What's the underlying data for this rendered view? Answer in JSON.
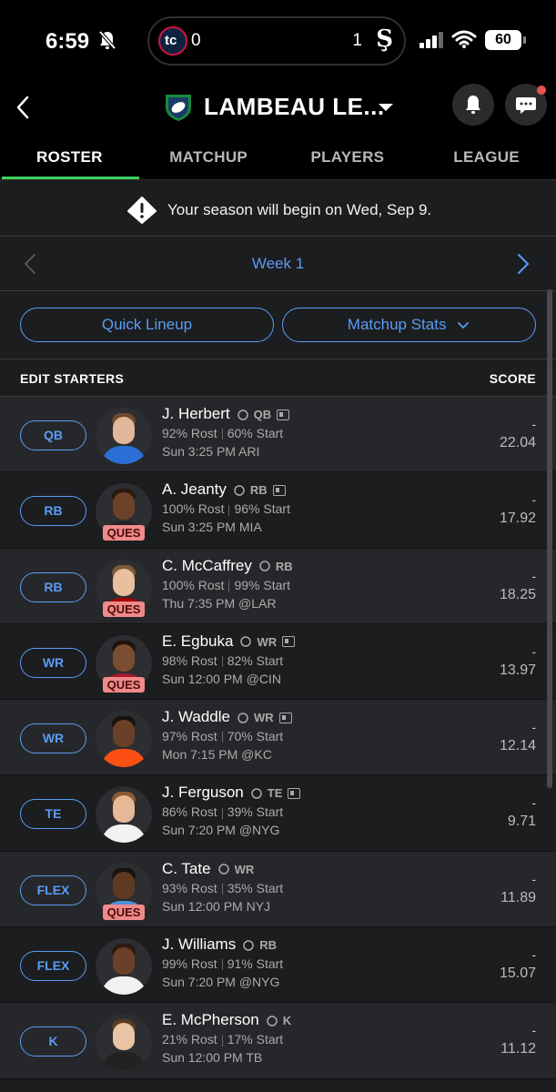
{
  "status_bar": {
    "time": "6:59",
    "live_score": {
      "team_a_score": "0",
      "team_b_score": "1"
    },
    "battery": "60"
  },
  "header": {
    "league_name": "LAMBEAU LE..."
  },
  "tabs": [
    {
      "label": "ROSTER",
      "active": true
    },
    {
      "label": "MATCHUP",
      "active": false
    },
    {
      "label": "PLAYERS",
      "active": false
    },
    {
      "label": "LEAGUE",
      "active": false
    }
  ],
  "notice": {
    "text": "Your season will begin on Wed, Sep 9."
  },
  "week": {
    "label": "Week 1"
  },
  "actions": {
    "quick_lineup": "Quick Lineup",
    "matchup_stats": "Matchup Stats"
  },
  "table_header": {
    "left": "EDIT STARTERS",
    "right": "SCORE"
  },
  "players": [
    {
      "slot": "QB",
      "name": "J. Herbert",
      "pos": "QB",
      "team_icon": "chargers-icon",
      "rost": "92% Rost",
      "start": "60% Start",
      "game": "Sun 3:25 PM  ARI",
      "score": "-",
      "proj": "22.04",
      "ques": false,
      "news": true,
      "skin": "#e2b89a",
      "hair": "#6b4a2e",
      "jersey": "#2a6fd6"
    },
    {
      "slot": "RB",
      "name": "A. Jeanty",
      "pos": "RB",
      "team_icon": "raiders-icon",
      "rost": "100% Rost",
      "start": "96% Start",
      "game": "Sun 3:25 PM  MIA",
      "score": "-",
      "proj": "17.92",
      "ques": true,
      "news": true,
      "skin": "#6b4228",
      "hair": "#2a1a10",
      "jersey": "#222"
    },
    {
      "slot": "RB",
      "name": "C. McCaffrey",
      "pos": "RB",
      "team_icon": "49ers-icon",
      "rost": "100% Rost",
      "start": "99% Start",
      "game": "Thu 7:35 PM  @LAR",
      "score": "-",
      "proj": "18.25",
      "ques": true,
      "news": false,
      "skin": "#e8c0a0",
      "hair": "#7a5a3a",
      "jersey": "#aa0000"
    },
    {
      "slot": "WR",
      "name": "E. Egbuka",
      "pos": "WR",
      "team_icon": "buccaneers-icon",
      "rost": "98% Rost",
      "start": "82% Start",
      "game": "Sun 12:00 PM  @CIN",
      "score": "-",
      "proj": "13.97",
      "ques": true,
      "news": true,
      "skin": "#7a4c30",
      "hair": "#1e140c",
      "jersey": "#a71930"
    },
    {
      "slot": "WR",
      "name": "J. Waddle",
      "pos": "WR",
      "team_icon": "broncos-icon",
      "rost": "97% Rost",
      "start": "70% Start",
      "game": "Mon 7:15 PM  @KC",
      "score": "-",
      "proj": "12.14",
      "ques": false,
      "news": true,
      "skin": "#6a4028",
      "hair": "#1a120c",
      "jersey": "#fb4f14"
    },
    {
      "slot": "TE",
      "name": "J. Ferguson",
      "pos": "TE",
      "team_icon": "cowboys-icon",
      "rost": "86% Rost",
      "start": "39% Start",
      "game": "Sun 7:20 PM  @NYG",
      "score": "-",
      "proj": "9.71",
      "ques": false,
      "news": true,
      "skin": "#e6b896",
      "hair": "#8a5a30",
      "jersey": "#f2f2f2"
    },
    {
      "slot": "FLEX",
      "name": "C. Tate",
      "pos": "WR",
      "team_icon": "titans-icon",
      "rost": "93% Rost",
      "start": "35% Start",
      "game": "Sun 12:00 PM  NYJ",
      "score": "-",
      "proj": "11.89",
      "ques": true,
      "news": false,
      "skin": "#5e3a22",
      "hair": "#1a120c",
      "jersey": "#4b92db"
    },
    {
      "slot": "FLEX",
      "name": "J. Williams",
      "pos": "RB",
      "team_icon": "cowboys-icon",
      "rost": "99% Rost",
      "start": "91% Start",
      "game": "Sun 7:20 PM  @NYG",
      "score": "-",
      "proj": "15.07",
      "ques": false,
      "news": false,
      "skin": "#6a4028",
      "hair": "#2a1a10",
      "jersey": "#f2f2f2"
    },
    {
      "slot": "K",
      "name": "E. McPherson",
      "pos": "K",
      "team_icon": "bengals-icon",
      "rost": "21% Rost",
      "start": "17% Start",
      "game": "Sun 12:00 PM  TB",
      "score": "-",
      "proj": "11.12",
      "ques": false,
      "news": false,
      "skin": "#e8c4a4",
      "hair": "#5a3a22",
      "jersey": "#222"
    }
  ],
  "colors": {
    "accent": "#5b9cf5",
    "active_tab": "#3bd15e",
    "ques_badge": "#f08a8a",
    "notif_dot": "#e8554e"
  }
}
